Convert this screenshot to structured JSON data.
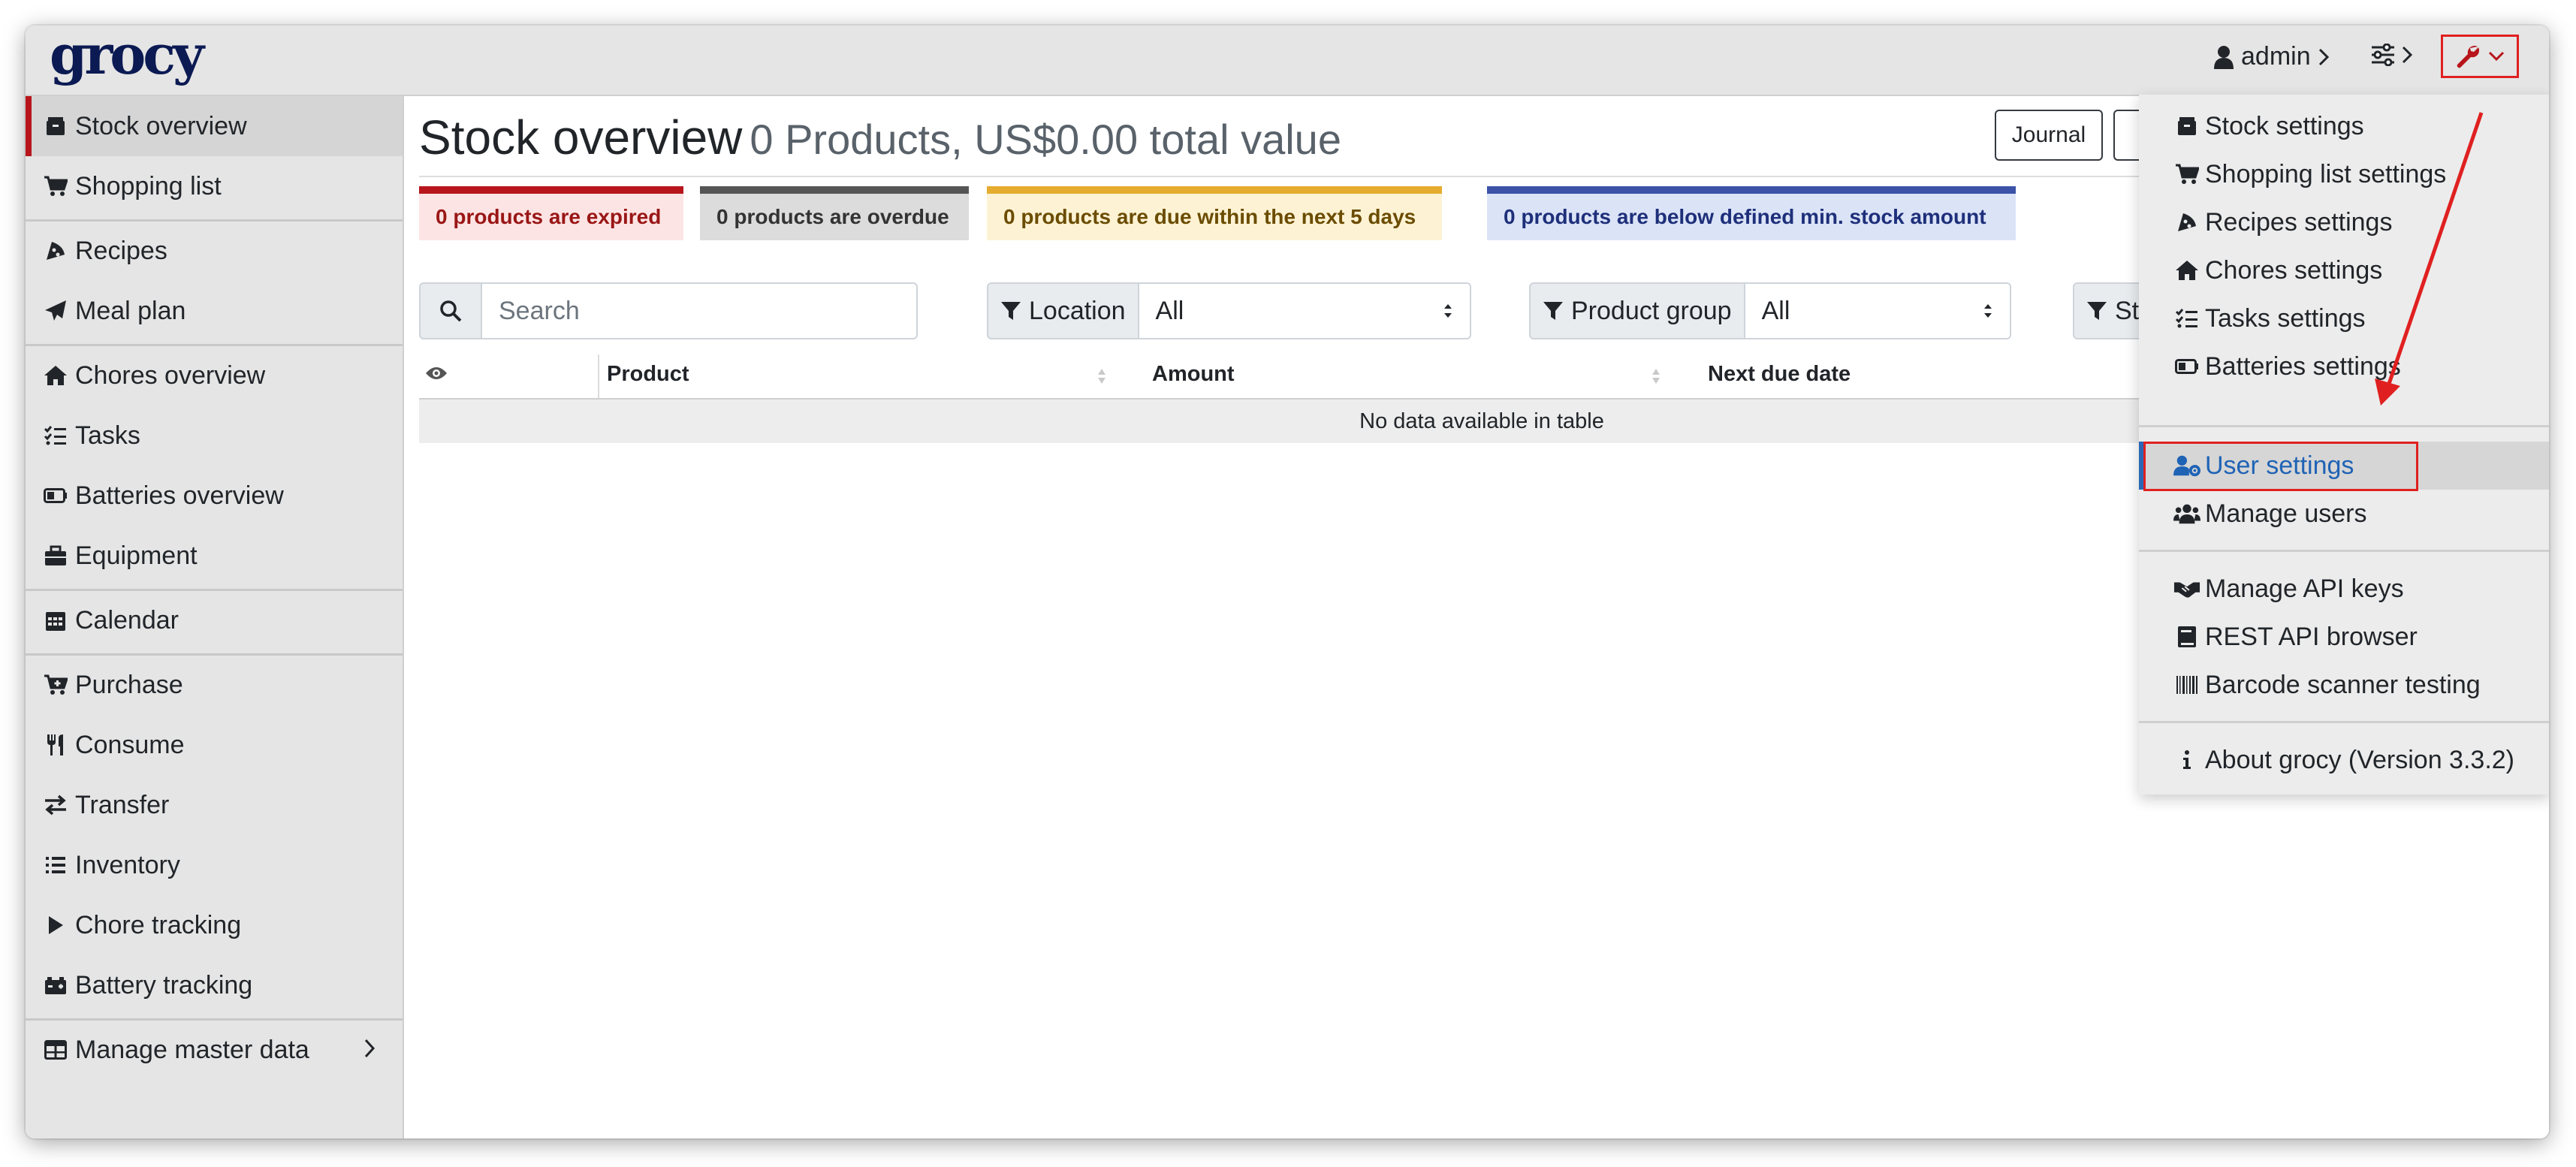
{
  "header": {
    "logo": "grocy",
    "user": "admin"
  },
  "sidebar": {
    "items": [
      {
        "label": "Stock overview",
        "icon": "box-icon",
        "active": true
      },
      {
        "label": "Shopping list",
        "icon": "cart-icon"
      },
      {
        "label": "Recipes",
        "icon": "pizza-icon"
      },
      {
        "label": "Meal plan",
        "icon": "paper-plane-icon"
      },
      {
        "label": "Chores overview",
        "icon": "home-icon"
      },
      {
        "label": "Tasks",
        "icon": "tasks-icon"
      },
      {
        "label": "Batteries overview",
        "icon": "battery-icon"
      },
      {
        "label": "Equipment",
        "icon": "toolbox-icon"
      },
      {
        "label": "Calendar",
        "icon": "calendar-icon"
      },
      {
        "label": "Purchase",
        "icon": "cart-plus-icon"
      },
      {
        "label": "Consume",
        "icon": "utensils-icon"
      },
      {
        "label": "Transfer",
        "icon": "exchange-icon"
      },
      {
        "label": "Inventory",
        "icon": "list-icon"
      },
      {
        "label": "Chore tracking",
        "icon": "play-icon"
      },
      {
        "label": "Battery tracking",
        "icon": "car-battery-icon"
      },
      {
        "label": "Manage master data",
        "icon": "table-icon"
      }
    ]
  },
  "main": {
    "title": "Stock overview",
    "subtitle": "0 Products, US$0.00 total value",
    "journal_button": "Journal",
    "alerts": [
      {
        "text": "0 products are expired"
      },
      {
        "text": "0 products are overdue"
      },
      {
        "text": "0 products are due within the next 5 days"
      },
      {
        "text": "0 products are below defined min. stock amount"
      }
    ],
    "search_placeholder": "Search",
    "location_label": "Location",
    "location_value": "All",
    "product_group_label": "Product group",
    "product_group_value": "All",
    "status_label_partial": "St",
    "table": {
      "columns": [
        "Product",
        "Amount",
        "Next due date"
      ],
      "empty_text": "No data available in table"
    }
  },
  "dropdown": {
    "items": [
      {
        "label": "Stock settings",
        "icon": "box-icon"
      },
      {
        "label": "Shopping list settings",
        "icon": "cart-icon"
      },
      {
        "label": "Recipes settings",
        "icon": "pizza-icon"
      },
      {
        "label": "Chores settings",
        "icon": "home-icon"
      },
      {
        "label": "Tasks settings",
        "icon": "tasks-icon"
      },
      {
        "label": "Batteries settings",
        "icon": "battery-icon"
      },
      {
        "label": "User settings",
        "icon": "user-cog-icon",
        "active": true
      },
      {
        "label": "Manage users",
        "icon": "users-icon"
      },
      {
        "label": "Manage API keys",
        "icon": "handshake-icon"
      },
      {
        "label": "REST API browser",
        "icon": "book-icon"
      },
      {
        "label": "Barcode scanner testing",
        "icon": "barcode-icon"
      },
      {
        "label": "About grocy (Version 3.3.2)",
        "icon": "info-icon"
      }
    ]
  },
  "colors": {
    "active_accent": "#b7151b",
    "link_blue": "#1f63b5",
    "annotation_red": "#e02020"
  }
}
